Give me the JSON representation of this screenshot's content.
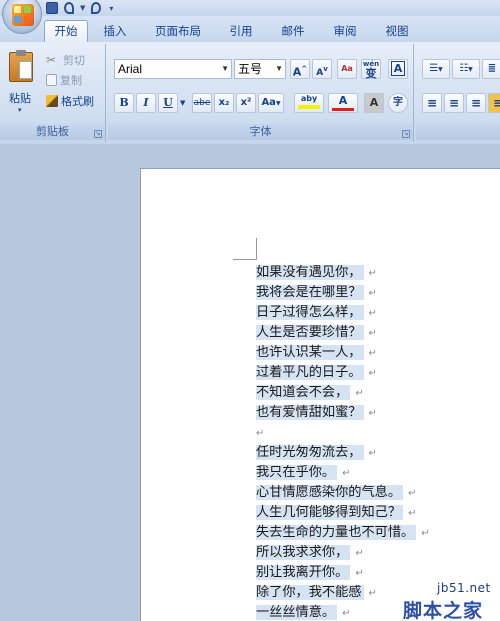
{
  "tabs": [
    "开始",
    "插入",
    "页面布局",
    "引用",
    "邮件",
    "审阅",
    "视图"
  ],
  "clipboard": {
    "paste": "粘贴",
    "cut": "剪切",
    "copy": "复制",
    "format_painter": "格式刷",
    "group": "剪贴板"
  },
  "font": {
    "name": "Arial",
    "size": "五号",
    "group": "字体",
    "bold": "B",
    "italic": "I",
    "underline": "U",
    "strike": "abe",
    "sub": "x₂",
    "sup": "x²",
    "case": "Aa",
    "grow": "A",
    "shrink": "A",
    "clear": "A",
    "phonetic": "wén",
    "border_char": "A",
    "highlight": "aby",
    "color": "A",
    "shade": "A",
    "enclose": "字"
  },
  "lines": [
    "如果没有遇见你，",
    "我将会是在哪里？",
    "日子过得怎么样，",
    "人生是否要珍惜？",
    "也许认识某一人，",
    "过着平凡的日子。",
    "不知道会不会，",
    "也有爱情甜如蜜？",
    "",
    "任时光匆匆流去，",
    "我只在乎你。",
    "心甘情愿感染你的气息。",
    "人生几何能够得到知己？",
    "失去生命的力量也不可惜。",
    "所以我求求你，",
    "别让我离开你。",
    "除了你，我不能感",
    "一丝丝情意。"
  ],
  "paragraph_mark": "↵",
  "watermark": {
    "site": "jb51.net",
    "name": "脚本之家"
  }
}
